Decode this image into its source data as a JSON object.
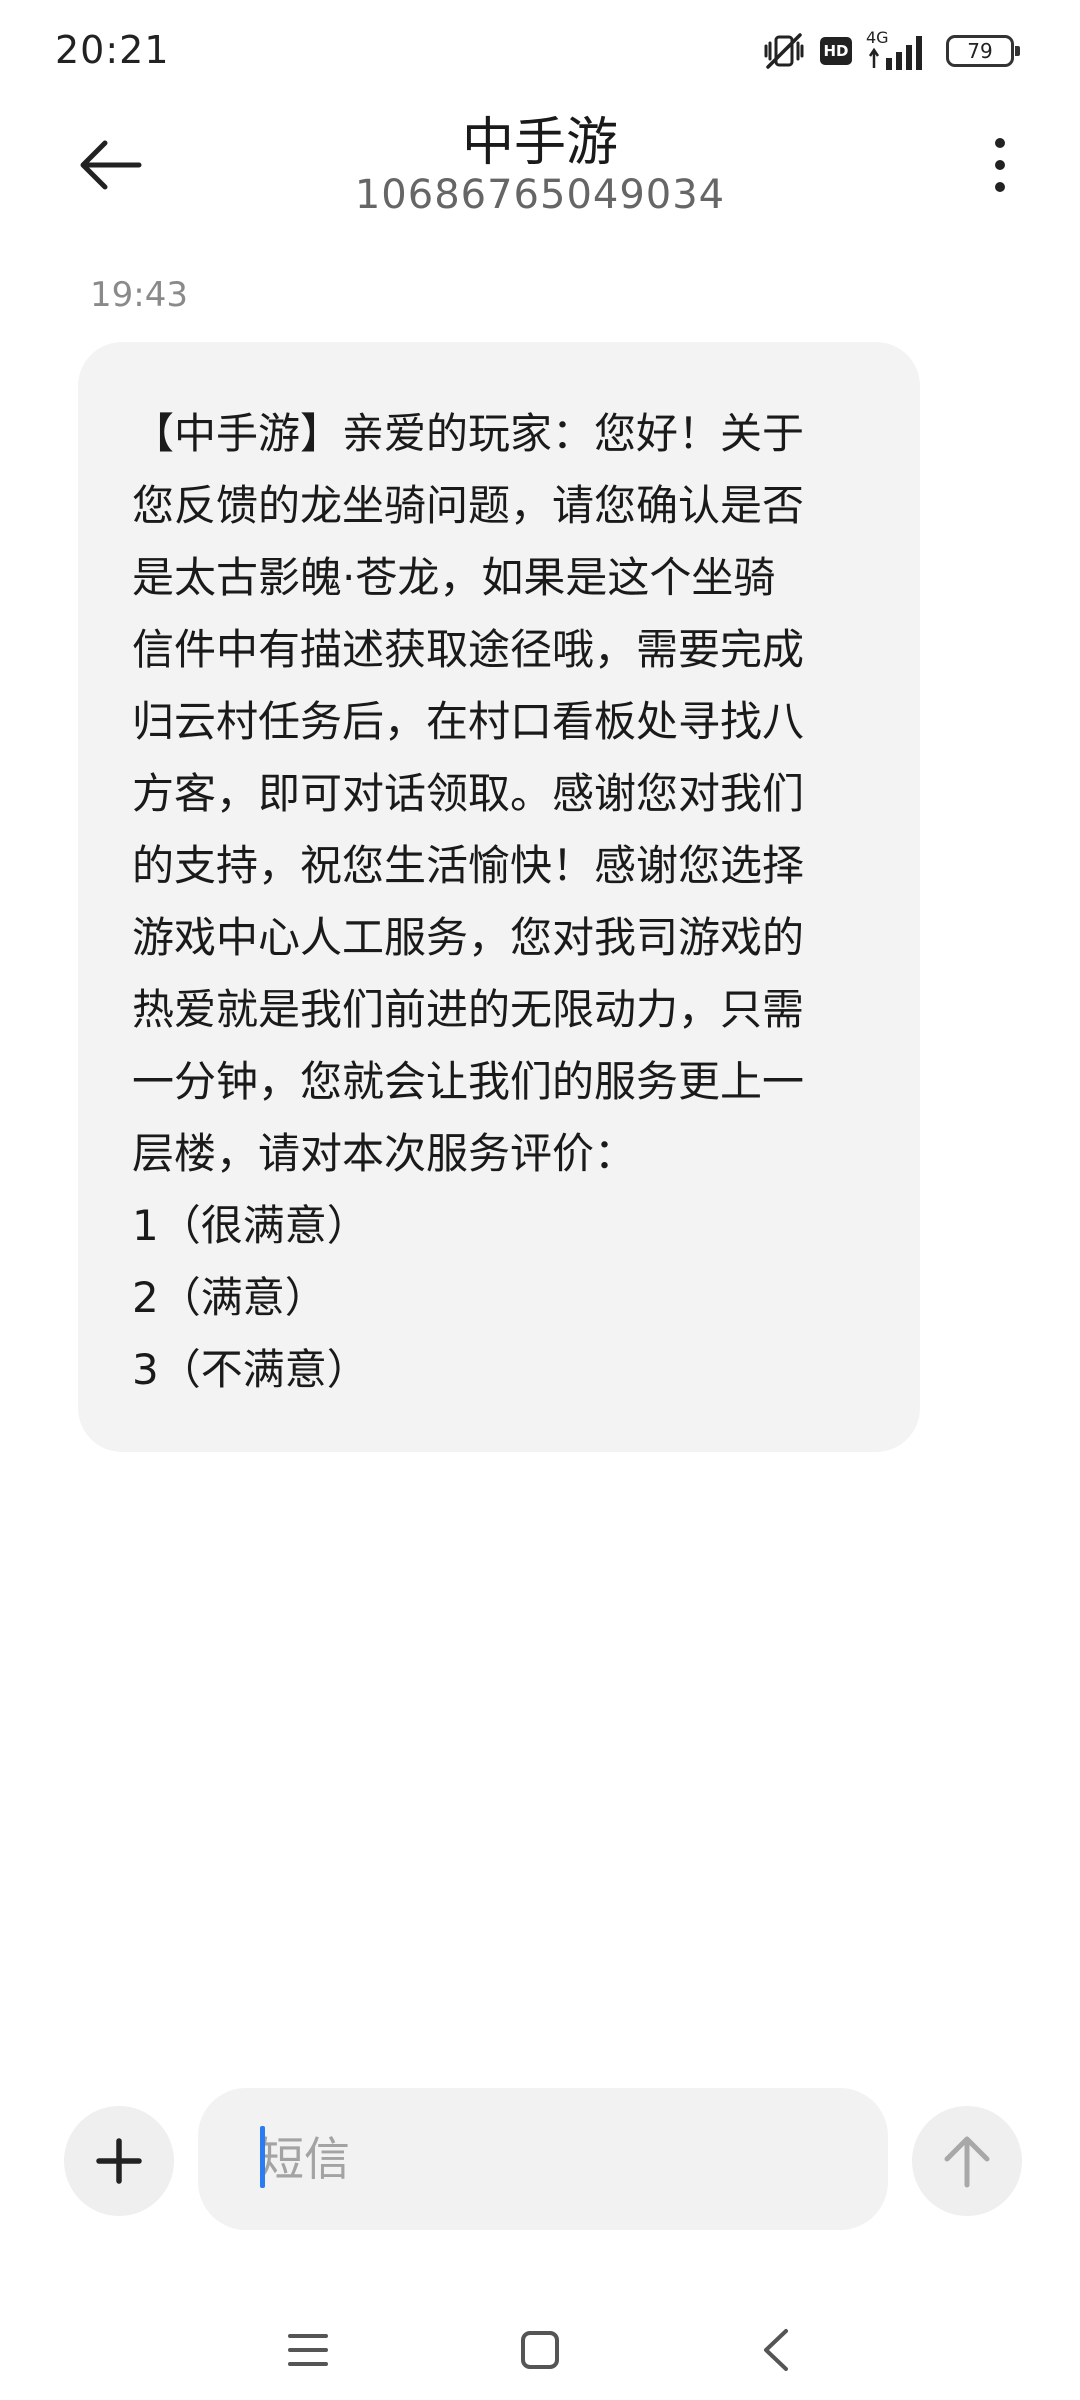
{
  "status_bar": {
    "time": "20:21",
    "network_generation": "4G",
    "hd_label": "HD",
    "battery_level": "79",
    "icons": [
      "mute-vibrate-icon",
      "hd-icon",
      "signal-icon",
      "battery-icon"
    ]
  },
  "header": {
    "contact_name": "中手游",
    "contact_number": "10686765049034",
    "icons": [
      "back-arrow-icon",
      "more-vertical-icon"
    ]
  },
  "conversation": {
    "messages": [
      {
        "timestamp": "19:43",
        "lines": [
          "【中手游】亲爱的玩家：您好！关于",
          "您反馈的龙坐骑问题，请您确认是否",
          "是太古影魄·苍龙，如果是这个坐骑",
          "信件中有描述获取途径哦，需要完成",
          "归云村任务后，在村口看板处寻找八",
          "方客，即可对话领取。感谢您对我们",
          "的支持，祝您生活愉快！感谢您选择",
          "游戏中心人工服务，您对我司游戏的",
          "热爱就是我们前进的无限动力，只需",
          "一分钟，您就会让我们的服务更上一",
          "层楼，请对本次服务评价：",
          "1（很满意）",
          "2（满意）",
          "3（不满意）"
        ]
      }
    ]
  },
  "composer": {
    "input_placeholder": "短信",
    "input_value": "",
    "icons": [
      "plus-icon",
      "send-arrow-up-icon"
    ]
  },
  "nav_bar": {
    "icons": [
      "menu-icon",
      "home-square-icon",
      "back-chevron-icon"
    ]
  },
  "colors": {
    "bubble_background": "#f3f3f3",
    "caret": "#2a7cf0",
    "button_background": "#efefef"
  }
}
